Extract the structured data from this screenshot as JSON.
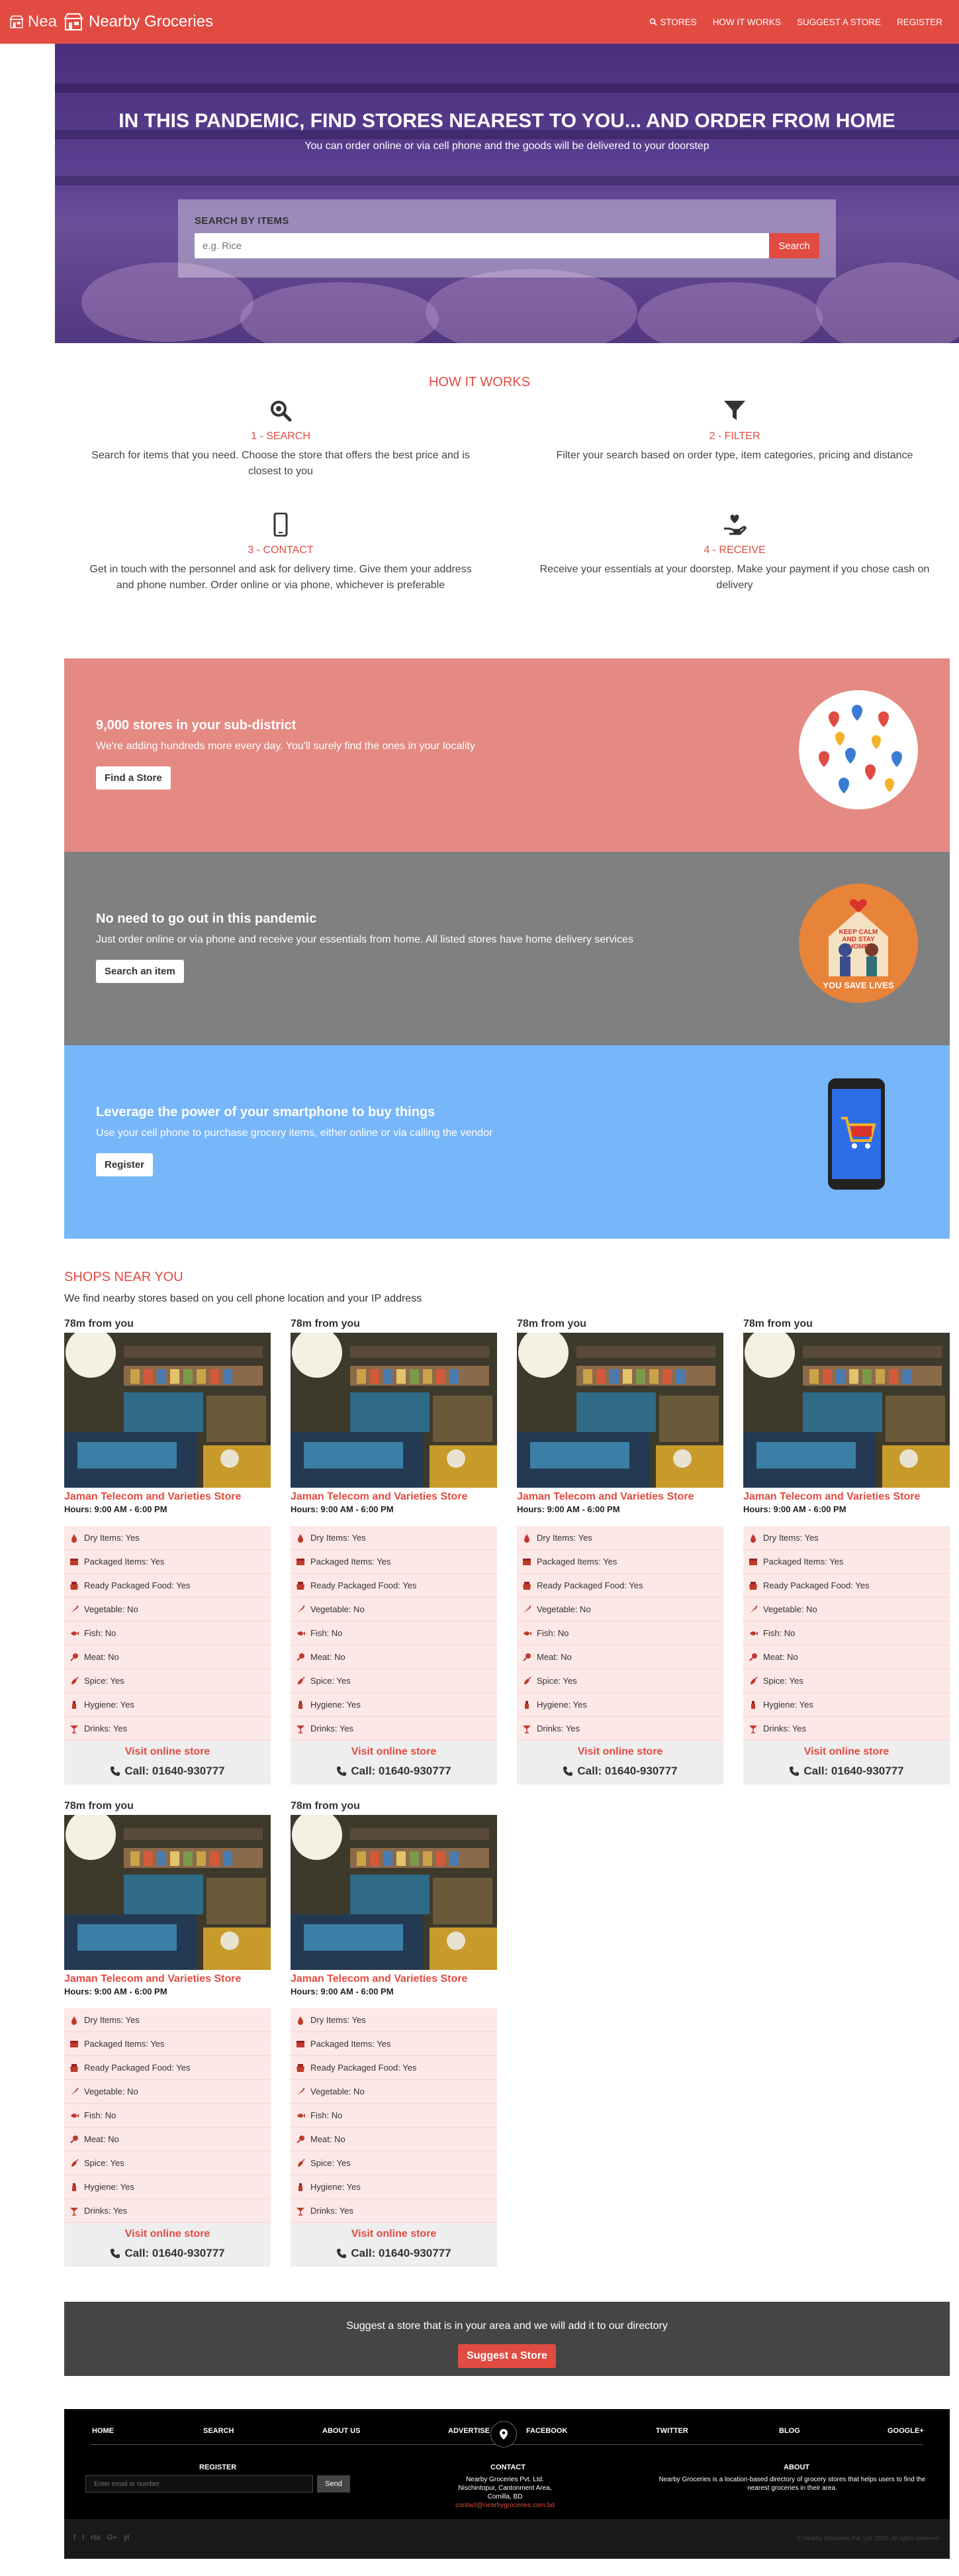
{
  "brand": {
    "name": "Nearby Groceries",
    "ghost": "Nea"
  },
  "nav": [
    {
      "label": "STORES",
      "icon": "search-icon"
    },
    {
      "label": "HOW IT WORKS"
    },
    {
      "label": "SUGGEST A STORE"
    },
    {
      "label": "REGISTER"
    }
  ],
  "hero": {
    "title": "IN THIS PANDEMIC, FIND STORES NEAREST TO YOU... AND ORDER FROM HOME",
    "subtitle": "You can order online or via cell phone and the goods will be delivered to your doorstep",
    "search_label": "SEARCH BY ITEMS",
    "search_placeholder": "e.g. Rice",
    "search_button": "Search"
  },
  "how": {
    "title": "HOW IT WORKS",
    "steps": [
      {
        "title": "1 - SEARCH",
        "text": "Search for items that you need. Choose the store that offers the best price and is closest to you",
        "icon": "search-icon"
      },
      {
        "title": "2 - FILTER",
        "text": "Filter your search based on order type, item categories, pricing and distance",
        "icon": "filter-icon"
      },
      {
        "title": "3 - CONTACT",
        "text": "Get in touch with the personnel and ask for delivery time. Give them your address and phone number. Order online or via phone, whichever is preferable",
        "icon": "phone-icon"
      },
      {
        "title": "4 - RECEIVE",
        "text": "Receive your essentials at your doorstep. Make your payment if you chose cash on delivery",
        "icon": "hand-heart-icon"
      }
    ]
  },
  "bands": [
    {
      "title": "9,000 stores in your sub-district",
      "text": "We're adding hundreds more every day. You'll surely find the ones in your locality",
      "button": "Find a Store",
      "color": "#e48a83"
    },
    {
      "title": "No need to go out in this pandemic",
      "text": "Just order online or via phone and receive your essentials from home. All listed stores have home delivery services",
      "button": "Search an item",
      "color": "#808080",
      "img_text1": "KEEP CALM AND STAY HOME",
      "img_text2": "YOU SAVE LIVES"
    },
    {
      "title": "Leverage the power of your smartphone to buy things",
      "text": "Use your cell phone to purchase grocery items, either online or via calling the vendor",
      "button": "Register",
      "color": "#77b6f9"
    }
  ],
  "shops": {
    "title": "SHOPS NEAR YOU",
    "subtitle": "We find nearby stores based on you cell phone location and your IP address",
    "cards": [
      {
        "distance": "78m from you",
        "name": "Jaman Telecom and Varieties Store",
        "hours": "Hours: 9:00 AM - 6:00 PM",
        "visit": "Visit online store",
        "call": "Call: 01640-930777"
      },
      {
        "distance": "78m from you",
        "name": "Jaman Telecom and Varieties Store",
        "hours": "Hours: 9:00 AM - 6:00 PM",
        "visit": "Visit online store",
        "call": "Call: 01640-930777"
      },
      {
        "distance": "78m from you",
        "name": "Jaman Telecom and Varieties Store",
        "hours": "Hours: 9:00 AM - 6:00 PM",
        "visit": "Visit online store",
        "call": "Call: 01640-930777"
      },
      {
        "distance": "78m from you",
        "name": "Jaman Telecom and Varieties Store",
        "hours": "Hours: 9:00 AM - 6:00 PM",
        "visit": "Visit online store",
        "call": "Call: 01640-930777"
      },
      {
        "distance": "78m from you",
        "name": "Jaman Telecom and Varieties Store",
        "hours": "Hours: 9:00 AM - 6:00 PM",
        "visit": "Visit online store",
        "call": "Call: 01640-930777"
      },
      {
        "distance": "78m from you",
        "name": "Jaman Telecom and Varieties Store",
        "hours": "Hours: 9:00 AM - 6:00 PM",
        "visit": "Visit online store",
        "call": "Call: 01640-930777"
      }
    ],
    "features": [
      {
        "label": "Dry Items: Yes",
        "icon": "drop-icon"
      },
      {
        "label": "Packaged Items: Yes",
        "icon": "package-icon"
      },
      {
        "label": "Ready Packaged Food: Yes",
        "icon": "food-box-icon"
      },
      {
        "label": "Vegetable: No",
        "icon": "carrot-icon"
      },
      {
        "label": "Fish: No",
        "icon": "fish-icon"
      },
      {
        "label": "Meat: No",
        "icon": "drumstick-icon"
      },
      {
        "label": "Spice: Yes",
        "icon": "pepper-icon"
      },
      {
        "label": "Hygiene: Yes",
        "icon": "bottle-icon"
      },
      {
        "label": "Drinks: Yes",
        "icon": "cocktail-icon"
      }
    ]
  },
  "suggest": {
    "text": "Suggest a store that is in your area and we will add it to our directory",
    "button": "Suggest a Store"
  },
  "footer": {
    "nav": [
      "HOME",
      "SEARCH",
      "ABOUT US",
      "ADVERTISE",
      "FACEBOOK",
      "TWITTER",
      "BLOG",
      "GOOGLE+"
    ],
    "register_title": "REGISTER",
    "email_placeholder": "Enter email or number",
    "send": "Send",
    "contact_title": "CONTACT",
    "contact_lines": [
      "Nearby Groceries Pvt. Ltd.",
      "Nischintopur, Cantonment Area,",
      "Comilla, BD"
    ],
    "contact_email": "contact@nearbygroceries.com.bd",
    "about_title": "ABOUT",
    "about_text": "Nearby Groceries is a location-based directory of grocery stores that helps users to find the nearest groceries in their area.",
    "social": [
      "f",
      "t",
      "rss",
      "G+",
      "yt"
    ],
    "copyright": "© Nearby Groceries Pvt. Ltd. 2020. All rights reserved."
  },
  "colors": {
    "accent": "#e14b42",
    "band1": "#e48a83",
    "band2": "#808080",
    "band3": "#77b6f9"
  }
}
